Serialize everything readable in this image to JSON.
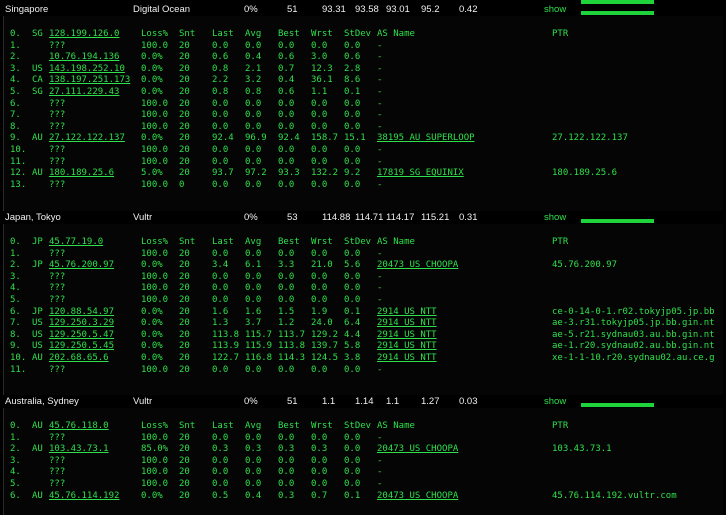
{
  "colors": {
    "background": "#000000",
    "text": "#2fe04a",
    "header_text": "#f0f0f0",
    "bar": "#1fd43a"
  },
  "columns": {
    "loss": "Loss%",
    "snt": "Snt",
    "last": "Last",
    "avg": "Avg",
    "best": "Best",
    "wrst": "Wrst",
    "stdev": "StDev",
    "as": "AS Name",
    "ptr": "PTR"
  },
  "show_label": "show",
  "sections": [
    {
      "location": "Singapore",
      "provider": "Digital Ocean",
      "stats": [
        "0%",
        "51",
        "93.31",
        "93.58",
        "93.01",
        "95.2",
        "0.42"
      ],
      "rows": [
        {
          "n": "0.",
          "cc": "SG",
          "host": "128.199.126.0",
          "loss": "100.0",
          "snt": "20",
          "last": "0.0",
          "avg": "0.0",
          "best": "0.0",
          "wrst": "0.0",
          "sd": "0.0",
          "as": "-",
          "ptr": ""
        },
        {
          "n": "1.",
          "cc": "",
          "host": "???",
          "loss": "100.0",
          "snt": "20",
          "last": "0.0",
          "avg": "0.0",
          "best": "0.0",
          "wrst": "0.0",
          "sd": "0.0",
          "as": "-",
          "ptr": ""
        },
        {
          "n": "2.",
          "cc": "",
          "host": "10.76.194.136",
          "loss": "0.0%",
          "snt": "20",
          "last": "0.6",
          "avg": "0.4",
          "best": "0.6",
          "wrst": "3.0",
          "sd": "0.6",
          "as": "-",
          "ptr": ""
        },
        {
          "n": "3.",
          "cc": "US",
          "host": "143.198.252.10",
          "loss": "0.0%",
          "snt": "20",
          "last": "0.8",
          "avg": "2.1",
          "best": "0.7",
          "wrst": "12.3",
          "sd": "2.8",
          "as": "-",
          "ptr": ""
        },
        {
          "n": "4.",
          "cc": "CA",
          "host": "138.197.251.173",
          "loss": "0.0%",
          "snt": "20",
          "last": "2.2",
          "avg": "3.2",
          "best": "0.4",
          "wrst": "36.1",
          "sd": "8.6",
          "as": "-",
          "ptr": ""
        },
        {
          "n": "5.",
          "cc": "SG",
          "host": "27.111.229.43",
          "loss": "0.0%",
          "snt": "20",
          "last": "0.8",
          "avg": "0.8",
          "best": "0.6",
          "wrst": "1.1",
          "sd": "0.1",
          "as": "-",
          "ptr": ""
        },
        {
          "n": "6.",
          "cc": "",
          "host": "???",
          "loss": "100.0",
          "snt": "20",
          "last": "0.0",
          "avg": "0.0",
          "best": "0.0",
          "wrst": "0.0",
          "sd": "0.0",
          "as": "-",
          "ptr": ""
        },
        {
          "n": "7.",
          "cc": "",
          "host": "???",
          "loss": "100.0",
          "snt": "20",
          "last": "0.0",
          "avg": "0.0",
          "best": "0.0",
          "wrst": "0.0",
          "sd": "0.0",
          "as": "-",
          "ptr": ""
        },
        {
          "n": "8.",
          "cc": "",
          "host": "???",
          "loss": "100.0",
          "snt": "20",
          "last": "0.0",
          "avg": "0.0",
          "best": "0.0",
          "wrst": "0.0",
          "sd": "0.0",
          "as": "-",
          "ptr": ""
        },
        {
          "n": "9.",
          "cc": "AU",
          "host": "27.122.122.137",
          "loss": "0.0%",
          "snt": "20",
          "last": "92.4",
          "avg": "96.9",
          "best": "92.4",
          "wrst": "158.7",
          "sd": "15.1",
          "as": "38195 AU SUPERLOOP",
          "ptr": "27.122.122.137"
        },
        {
          "n": "10.",
          "cc": "",
          "host": "???",
          "loss": "100.0",
          "snt": "20",
          "last": "0.0",
          "avg": "0.0",
          "best": "0.0",
          "wrst": "0.0",
          "sd": "0.0",
          "as": "-",
          "ptr": ""
        },
        {
          "n": "11.",
          "cc": "",
          "host": "???",
          "loss": "100.0",
          "snt": "20",
          "last": "0.0",
          "avg": "0.0",
          "best": "0.0",
          "wrst": "0.0",
          "sd": "0.0",
          "as": "-",
          "ptr": ""
        },
        {
          "n": "12.",
          "cc": "AU",
          "host": "180.189.25.6",
          "loss": "5.0%",
          "snt": "20",
          "last": "93.7",
          "avg": "97.2",
          "best": "93.3",
          "wrst": "132.2",
          "sd": "9.2",
          "as": "17819 SG EQUINIX",
          "ptr": "180.189.25.6"
        },
        {
          "n": "13.",
          "cc": "",
          "host": "???",
          "loss": "100.0",
          "snt": "0",
          "last": "0.0",
          "avg": "0.0",
          "best": "0.0",
          "wrst": "0.0",
          "sd": "0.0",
          "as": "-",
          "ptr": ""
        }
      ]
    },
    {
      "location": "Japan, Tokyo",
      "provider": "Vultr",
      "stats": [
        "0%",
        "53",
        "114.88",
        "114.71",
        "114.17",
        "115.21",
        "0.31"
      ],
      "rows": [
        {
          "n": "0.",
          "cc": "JP",
          "host": "45.77.19.0",
          "loss": "Loss%",
          "snt": "Snt",
          "last": "Last",
          "avg": "Avg",
          "best": "Best",
          "wrst": "Wrst",
          "sd": "StDev",
          "as": "AS Name",
          "ptr": "PTR"
        },
        {
          "n": "1.",
          "cc": "",
          "host": "???",
          "loss": "100.0",
          "snt": "20",
          "last": "0.0",
          "avg": "0.0",
          "best": "0.0",
          "wrst": "0.0",
          "sd": "0.0",
          "as": "-",
          "ptr": ""
        },
        {
          "n": "2.",
          "cc": "JP",
          "host": "45.76.200.97",
          "loss": "0.0%",
          "snt": "20",
          "last": "3.4",
          "avg": "6.1",
          "best": "3.3",
          "wrst": "21.0",
          "sd": "5.6",
          "as": "20473 US CHOOPA",
          "ptr": "45.76.200.97"
        },
        {
          "n": "3.",
          "cc": "",
          "host": "???",
          "loss": "100.0",
          "snt": "20",
          "last": "0.0",
          "avg": "0.0",
          "best": "0.0",
          "wrst": "0.0",
          "sd": "0.0",
          "as": "-",
          "ptr": ""
        },
        {
          "n": "4.",
          "cc": "",
          "host": "???",
          "loss": "100.0",
          "snt": "20",
          "last": "0.0",
          "avg": "0.0",
          "best": "0.0",
          "wrst": "0.0",
          "sd": "0.0",
          "as": "-",
          "ptr": ""
        },
        {
          "n": "5.",
          "cc": "",
          "host": "???",
          "loss": "100.0",
          "snt": "20",
          "last": "0.0",
          "avg": "0.0",
          "best": "0.0",
          "wrst": "0.0",
          "sd": "0.0",
          "as": "-",
          "ptr": ""
        },
        {
          "n": "6.",
          "cc": "JP",
          "host": "120.88.54.97",
          "loss": "0.0%",
          "snt": "20",
          "last": "1.6",
          "avg": "1.6",
          "best": "1.5",
          "wrst": "1.9",
          "sd": "0.1",
          "as": "2914  US NTT",
          "ptr": "ce-0-14-0-1.r02.tokyjp05.jp.bb"
        },
        {
          "n": "7.",
          "cc": "US",
          "host": "129.250.3.29",
          "loss": "0.0%",
          "snt": "20",
          "last": "1.3",
          "avg": "3.7",
          "best": "1.2",
          "wrst": "24.0",
          "sd": "6.4",
          "as": "2914  US NTT",
          "ptr": "ae-3.r31.tokyjp05.jp.bb.gin.nt"
        },
        {
          "n": "8.",
          "cc": "US",
          "host": "129.250.5.47",
          "loss": "0.0%",
          "snt": "20",
          "last": "113.8",
          "avg": "115.7",
          "best": "113.7",
          "wrst": "129.2",
          "sd": "4.4",
          "as": "2914  US NTT",
          "ptr": "ae-5.r21.sydnau03.au.bb.gin.nt"
        },
        {
          "n": "9.",
          "cc": "US",
          "host": "129.250.5.45",
          "loss": "0.0%",
          "snt": "20",
          "last": "113.9",
          "avg": "115.9",
          "best": "113.8",
          "wrst": "139.7",
          "sd": "5.8",
          "as": "2914  US NTT",
          "ptr": "ae-1.r20.sydnau02.au.bb.gin.nt"
        },
        {
          "n": "10.",
          "cc": "AU",
          "host": "202.68.65.6",
          "loss": "0.0%",
          "snt": "20",
          "last": "122.7",
          "avg": "116.8",
          "best": "114.3",
          "wrst": "124.5",
          "sd": "3.8",
          "as": "2914  US NTT",
          "ptr": "xe-1-1-10.r20.sydnau02.au.ce.g"
        },
        {
          "n": "11.",
          "cc": "",
          "host": "???",
          "loss": "100.0",
          "snt": "20",
          "last": "0.0",
          "avg": "0.0",
          "best": "0.0",
          "wrst": "0.0",
          "sd": "0.0",
          "as": "-",
          "ptr": ""
        }
      ]
    },
    {
      "location": "Australia, Sydney",
      "provider": "Vultr",
      "stats": [
        "0%",
        "51",
        "1.1",
        "1.14",
        "1.1",
        "1.27",
        "0.03"
      ],
      "rows": [
        {
          "n": "0.",
          "cc": "AU",
          "host": "45.76.118.0",
          "loss": "Loss%",
          "snt": "Snt",
          "last": "Last",
          "avg": "Avg",
          "best": "Best",
          "wrst": "Wrst",
          "sd": "StDev",
          "as": "AS Name",
          "ptr": "PTR"
        },
        {
          "n": "1.",
          "cc": "",
          "host": "???",
          "loss": "100.0",
          "snt": "20",
          "last": "0.0",
          "avg": "0.0",
          "best": "0.0",
          "wrst": "0.0",
          "sd": "0.0",
          "as": "-",
          "ptr": ""
        },
        {
          "n": "2.",
          "cc": "AU",
          "host": "103.43.73.1",
          "loss": "85.0%",
          "snt": "20",
          "last": "0.3",
          "avg": "0.3",
          "best": "0.3",
          "wrst": "0.3",
          "sd": "0.0",
          "as": "20473 US CHOOPA",
          "ptr": "103.43.73.1"
        },
        {
          "n": "3.",
          "cc": "",
          "host": "???",
          "loss": "100.0",
          "snt": "20",
          "last": "0.0",
          "avg": "0.0",
          "best": "0.0",
          "wrst": "0.0",
          "sd": "0.0",
          "as": "-",
          "ptr": ""
        },
        {
          "n": "4.",
          "cc": "",
          "host": "???",
          "loss": "100.0",
          "snt": "20",
          "last": "0.0",
          "avg": "0.0",
          "best": "0.0",
          "wrst": "0.0",
          "sd": "0.0",
          "as": "-",
          "ptr": ""
        },
        {
          "n": "5.",
          "cc": "",
          "host": "???",
          "loss": "100.0",
          "snt": "20",
          "last": "0.0",
          "avg": "0.0",
          "best": "0.0",
          "wrst": "0.0",
          "sd": "0.0",
          "as": "-",
          "ptr": ""
        },
        {
          "n": "6.",
          "cc": "AU",
          "host": "45.76.114.192",
          "loss": "0.0%",
          "snt": "20",
          "last": "0.5",
          "avg": "0.4",
          "best": "0.3",
          "wrst": "0.7",
          "sd": "0.1",
          "as": "20473 US CHOOPA",
          "ptr": "45.76.114.192.vultr.com"
        }
      ]
    }
  ]
}
